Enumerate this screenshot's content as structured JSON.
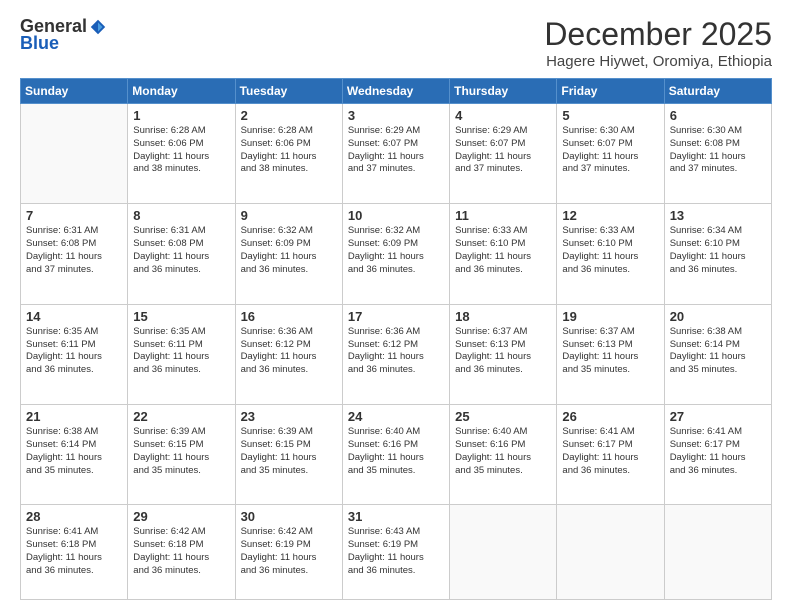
{
  "header": {
    "logo_general": "General",
    "logo_blue": "Blue",
    "month": "December 2025",
    "location": "Hagere Hiywet, Oromiya, Ethiopia"
  },
  "weekdays": [
    "Sunday",
    "Monday",
    "Tuesday",
    "Wednesday",
    "Thursday",
    "Friday",
    "Saturday"
  ],
  "weeks": [
    [
      {
        "day": "",
        "info": ""
      },
      {
        "day": "1",
        "info": "Sunrise: 6:28 AM\nSunset: 6:06 PM\nDaylight: 11 hours\nand 38 minutes."
      },
      {
        "day": "2",
        "info": "Sunrise: 6:28 AM\nSunset: 6:06 PM\nDaylight: 11 hours\nand 38 minutes."
      },
      {
        "day": "3",
        "info": "Sunrise: 6:29 AM\nSunset: 6:07 PM\nDaylight: 11 hours\nand 37 minutes."
      },
      {
        "day": "4",
        "info": "Sunrise: 6:29 AM\nSunset: 6:07 PM\nDaylight: 11 hours\nand 37 minutes."
      },
      {
        "day": "5",
        "info": "Sunrise: 6:30 AM\nSunset: 6:07 PM\nDaylight: 11 hours\nand 37 minutes."
      },
      {
        "day": "6",
        "info": "Sunrise: 6:30 AM\nSunset: 6:08 PM\nDaylight: 11 hours\nand 37 minutes."
      }
    ],
    [
      {
        "day": "7",
        "info": "Sunrise: 6:31 AM\nSunset: 6:08 PM\nDaylight: 11 hours\nand 37 minutes."
      },
      {
        "day": "8",
        "info": "Sunrise: 6:31 AM\nSunset: 6:08 PM\nDaylight: 11 hours\nand 36 minutes."
      },
      {
        "day": "9",
        "info": "Sunrise: 6:32 AM\nSunset: 6:09 PM\nDaylight: 11 hours\nand 36 minutes."
      },
      {
        "day": "10",
        "info": "Sunrise: 6:32 AM\nSunset: 6:09 PM\nDaylight: 11 hours\nand 36 minutes."
      },
      {
        "day": "11",
        "info": "Sunrise: 6:33 AM\nSunset: 6:10 PM\nDaylight: 11 hours\nand 36 minutes."
      },
      {
        "day": "12",
        "info": "Sunrise: 6:33 AM\nSunset: 6:10 PM\nDaylight: 11 hours\nand 36 minutes."
      },
      {
        "day": "13",
        "info": "Sunrise: 6:34 AM\nSunset: 6:10 PM\nDaylight: 11 hours\nand 36 minutes."
      }
    ],
    [
      {
        "day": "14",
        "info": "Sunrise: 6:35 AM\nSunset: 6:11 PM\nDaylight: 11 hours\nand 36 minutes."
      },
      {
        "day": "15",
        "info": "Sunrise: 6:35 AM\nSunset: 6:11 PM\nDaylight: 11 hours\nand 36 minutes."
      },
      {
        "day": "16",
        "info": "Sunrise: 6:36 AM\nSunset: 6:12 PM\nDaylight: 11 hours\nand 36 minutes."
      },
      {
        "day": "17",
        "info": "Sunrise: 6:36 AM\nSunset: 6:12 PM\nDaylight: 11 hours\nand 36 minutes."
      },
      {
        "day": "18",
        "info": "Sunrise: 6:37 AM\nSunset: 6:13 PM\nDaylight: 11 hours\nand 36 minutes."
      },
      {
        "day": "19",
        "info": "Sunrise: 6:37 AM\nSunset: 6:13 PM\nDaylight: 11 hours\nand 35 minutes."
      },
      {
        "day": "20",
        "info": "Sunrise: 6:38 AM\nSunset: 6:14 PM\nDaylight: 11 hours\nand 35 minutes."
      }
    ],
    [
      {
        "day": "21",
        "info": "Sunrise: 6:38 AM\nSunset: 6:14 PM\nDaylight: 11 hours\nand 35 minutes."
      },
      {
        "day": "22",
        "info": "Sunrise: 6:39 AM\nSunset: 6:15 PM\nDaylight: 11 hours\nand 35 minutes."
      },
      {
        "day": "23",
        "info": "Sunrise: 6:39 AM\nSunset: 6:15 PM\nDaylight: 11 hours\nand 35 minutes."
      },
      {
        "day": "24",
        "info": "Sunrise: 6:40 AM\nSunset: 6:16 PM\nDaylight: 11 hours\nand 35 minutes."
      },
      {
        "day": "25",
        "info": "Sunrise: 6:40 AM\nSunset: 6:16 PM\nDaylight: 11 hours\nand 35 minutes."
      },
      {
        "day": "26",
        "info": "Sunrise: 6:41 AM\nSunset: 6:17 PM\nDaylight: 11 hours\nand 36 minutes."
      },
      {
        "day": "27",
        "info": "Sunrise: 6:41 AM\nSunset: 6:17 PM\nDaylight: 11 hours\nand 36 minutes."
      }
    ],
    [
      {
        "day": "28",
        "info": "Sunrise: 6:41 AM\nSunset: 6:18 PM\nDaylight: 11 hours\nand 36 minutes."
      },
      {
        "day": "29",
        "info": "Sunrise: 6:42 AM\nSunset: 6:18 PM\nDaylight: 11 hours\nand 36 minutes."
      },
      {
        "day": "30",
        "info": "Sunrise: 6:42 AM\nSunset: 6:19 PM\nDaylight: 11 hours\nand 36 minutes."
      },
      {
        "day": "31",
        "info": "Sunrise: 6:43 AM\nSunset: 6:19 PM\nDaylight: 11 hours\nand 36 minutes."
      },
      {
        "day": "",
        "info": ""
      },
      {
        "day": "",
        "info": ""
      },
      {
        "day": "",
        "info": ""
      }
    ]
  ]
}
